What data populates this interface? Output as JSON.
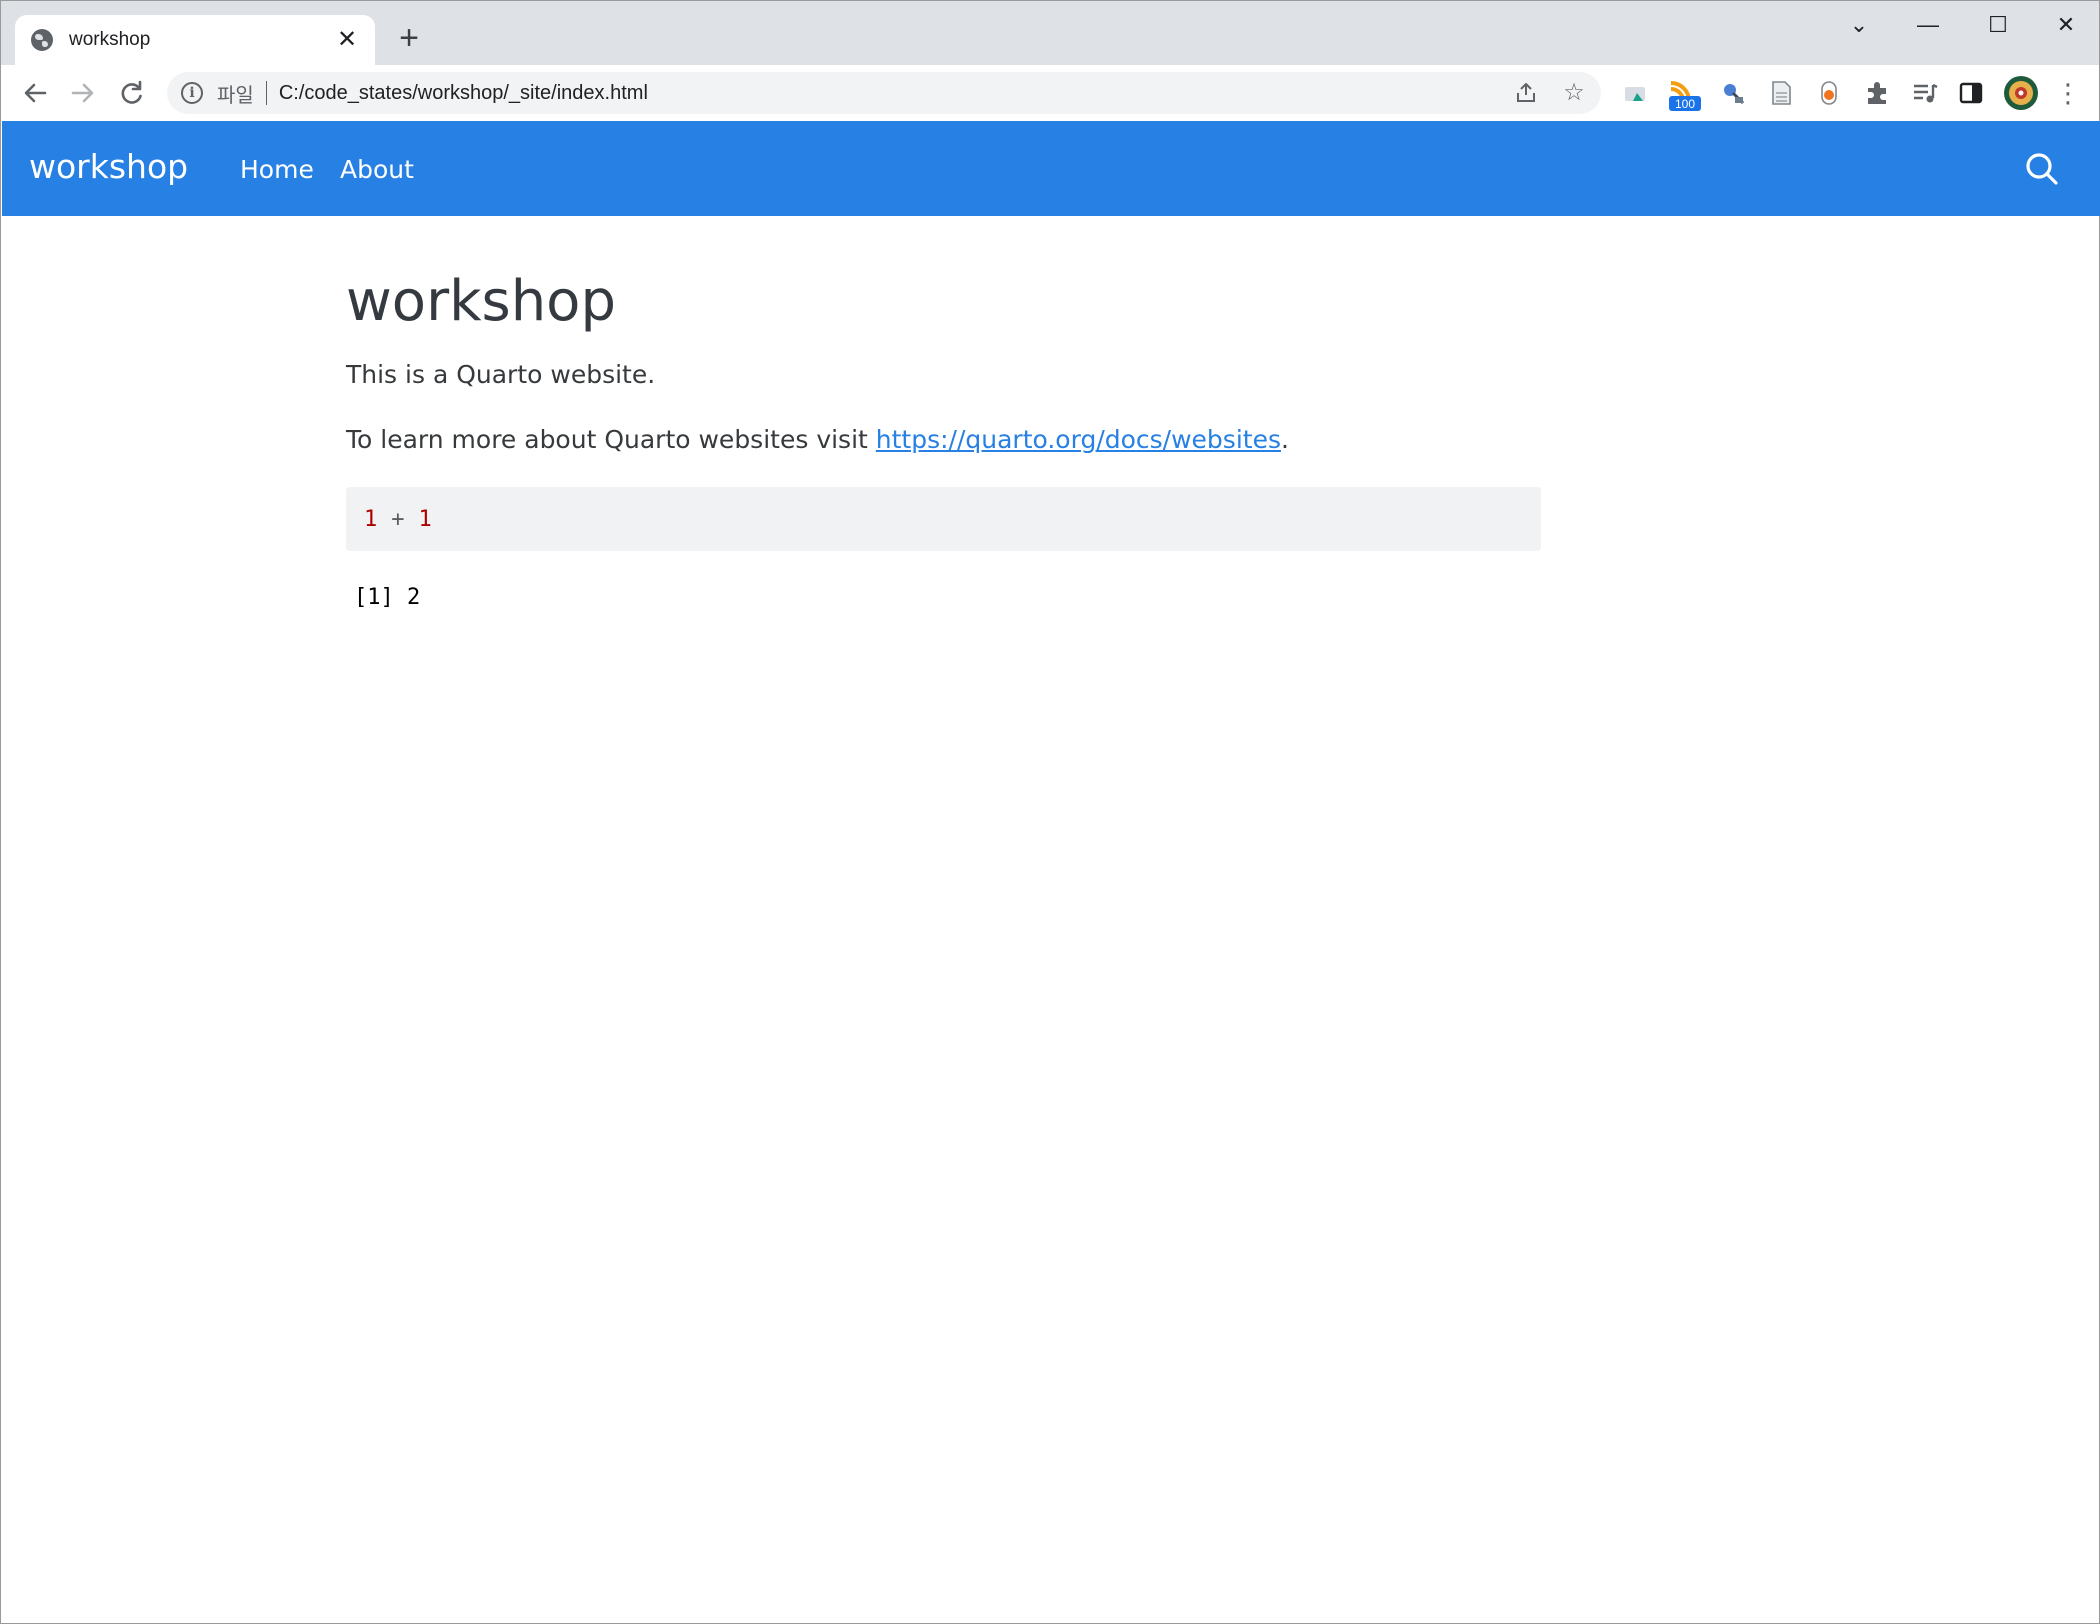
{
  "browser": {
    "tab_title": "workshop",
    "tab_close": "✕",
    "new_tab": "+",
    "scheme_label": "파일",
    "url": "C:/code_states/workshop/_site/index.html",
    "extension_badge": "100"
  },
  "window_controls": {
    "dropdown": "⌄",
    "minimize": "—",
    "maximize": "☐",
    "close": "✕"
  },
  "navbar": {
    "brand": "workshop",
    "links": [
      "Home",
      "About"
    ]
  },
  "main": {
    "title": "workshop",
    "intro": "This is a Quarto website.",
    "learn_more_prefix": "To learn more about Quarto websites visit ",
    "learn_more_link": "https://quarto.org/docs/websites",
    "learn_more_suffix": ".",
    "code": {
      "left": "1",
      "operator": "+",
      "right": "1"
    },
    "output": "[1] 2"
  },
  "colors": {
    "navbar": "#2780e3",
    "link": "#2780e3",
    "code_number": "#ad0000",
    "code_background": "#f0f2f3"
  }
}
